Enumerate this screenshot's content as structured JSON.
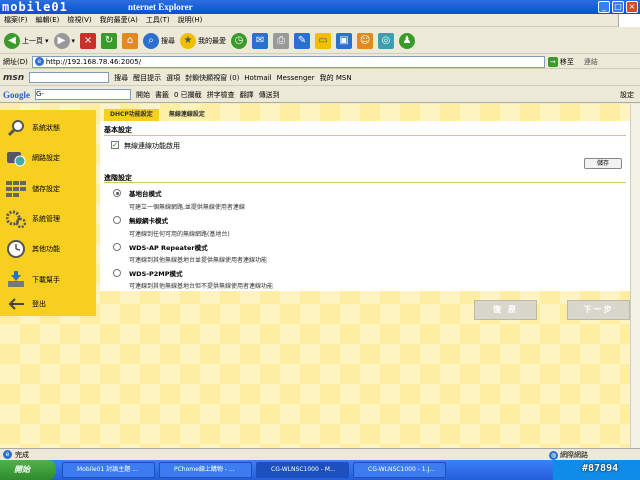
{
  "watermark_top": "mobile01",
  "window_title": "nternet Explorer",
  "menu": [
    "檔案(F)",
    "編輯(E)",
    "檢視(V)",
    "我的最愛(A)",
    "工具(T)",
    "說明(H)"
  ],
  "toolbar": {
    "back": "上一頁",
    "search": "搜尋",
    "favorites": "我的最愛"
  },
  "address": {
    "label": "網址(D)",
    "url": "http://192.168.78.46:2005/",
    "go": "移至",
    "links": "連結"
  },
  "msnbar": {
    "logo": "msn",
    "search": "搜尋",
    "highlight": "醒目提示",
    "options": "選項",
    "popup": "封鎖快顯視窗 (0)",
    "hotmail": "Hotmail",
    "messenger": "Messenger",
    "mymsn": "我的 MSN"
  },
  "googlebar": {
    "logo": "Google",
    "field": "G-",
    "start": "開始",
    "bookmarks": "書籤",
    "blocked": "0 已攔截",
    "spell": "拼字檢查",
    "translate": "翻譯",
    "send": "傳送到",
    "settings": "設定"
  },
  "sidenav": [
    {
      "label": "系統狀態",
      "icon": "magnifier-icon"
    },
    {
      "label": "網路設定",
      "icon": "network-globe-icon"
    },
    {
      "label": "儲存設定",
      "icon": "grid-blocks-icon"
    },
    {
      "label": "系統管理",
      "icon": "gears-icon"
    },
    {
      "label": "其他功能",
      "icon": "clock-icon"
    },
    {
      "label": "下載幫手",
      "icon": "download-icon"
    },
    {
      "label": "登出",
      "icon": "logout-arrow-icon"
    }
  ],
  "tabs": [
    "DHCP功能設定",
    "無線連線設定"
  ],
  "basic": {
    "heading": "基本設定",
    "enable_label": "無線連線功能啟用",
    "enabled": true,
    "save": "儲存"
  },
  "advanced": {
    "heading": "進階設定",
    "options": [
      {
        "title": "基地台模式",
        "desc": "可建立一個無線網路,並提供無線使用者連線",
        "selected": true
      },
      {
        "title": "無線網卡模式",
        "desc": "可連線到任何可用的無線網路(基地台)",
        "selected": false
      },
      {
        "title": "WDS-AP Repeater模式",
        "desc": "可連線到其他無線基地台並提供無線使用者連線功能",
        "selected": false
      },
      {
        "title": "WDS-P2MP模式",
        "desc": "可連線到其他無線基地台但不提供無線使用者連線功能",
        "selected": false
      }
    ]
  },
  "buttons": {
    "reset": "復 原",
    "next": "下一步"
  },
  "status": {
    "left": "完成",
    "zone": "網際網路"
  },
  "taskbar": {
    "start": "開始",
    "tasks": [
      "Mobile01 討論主題 ...",
      "PChome線上購物 - ...",
      "CG-WLNSC1000 - M...",
      "CG-WLNSC1000 - 1.J..."
    ]
  },
  "watermark_bottom": "#87894",
  "colors": {
    "nav": "#f7cf1e",
    "page_bg": "#fdeea2",
    "tab_active": "#fff0a8"
  }
}
